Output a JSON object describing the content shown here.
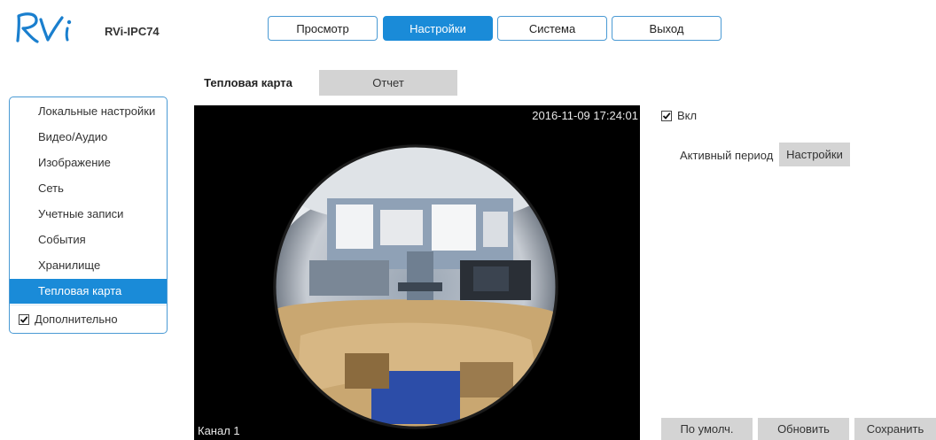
{
  "header": {
    "logo_text": "RVi",
    "model": "RVi-IPC74",
    "nav": [
      {
        "label": "Просмотр",
        "active": false
      },
      {
        "label": "Настройки",
        "active": true
      },
      {
        "label": "Система",
        "active": false
      },
      {
        "label": "Выход",
        "active": false
      }
    ]
  },
  "tabs": [
    {
      "label": "Тепловая карта",
      "active": true
    },
    {
      "label": "Отчет",
      "active": false
    }
  ],
  "sidebar": {
    "items": [
      {
        "label": "Локальные настройки",
        "active": false
      },
      {
        "label": "Видео/Аудио",
        "active": false
      },
      {
        "label": "Изображение",
        "active": false
      },
      {
        "label": "Сеть",
        "active": false
      },
      {
        "label": "Учетные записи",
        "active": false
      },
      {
        "label": "События",
        "active": false
      },
      {
        "label": "Хранилище",
        "active": false
      },
      {
        "label": "Тепловая карта",
        "active": true
      }
    ],
    "advanced": {
      "label": "Дополнительно",
      "checked": true
    }
  },
  "video": {
    "timestamp": "2016-11-09 17:24:01",
    "channel": "Канал 1"
  },
  "settings": {
    "enable_label": "Вкл",
    "enable_checked": true,
    "active_period_label": "Активный период",
    "active_period_button": "Настройки"
  },
  "actions": {
    "default": "По умолч.",
    "refresh": "Обновить",
    "save": "Сохранить"
  },
  "colors": {
    "accent": "#1a8bd8",
    "border": "#4a9ad4",
    "logo": "#1a7fce",
    "gray_button": "#d4d4d4"
  }
}
